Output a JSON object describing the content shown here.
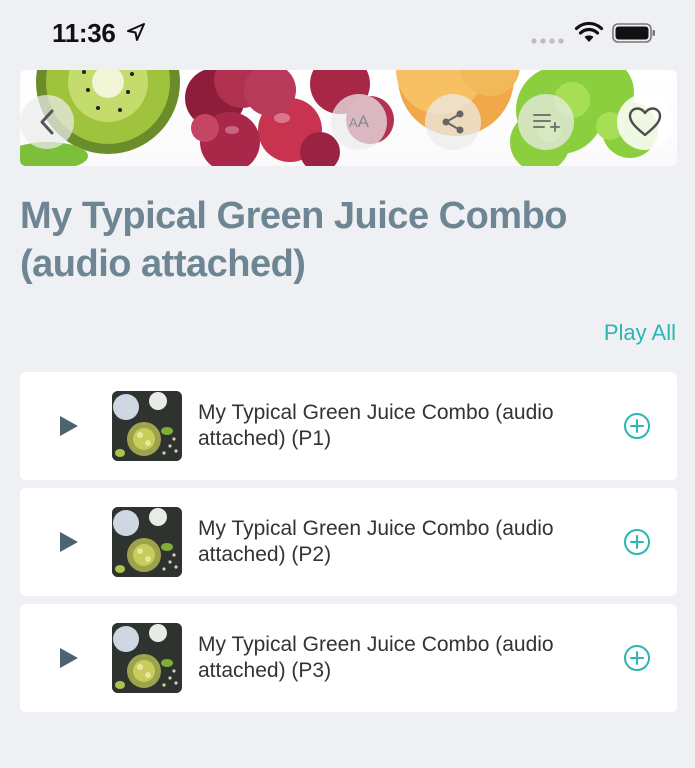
{
  "status_bar": {
    "time": "11:36"
  },
  "hero": {
    "font_button_label_big": "A",
    "font_button_label_small": "A"
  },
  "page": {
    "title": "My Typical Green Juice Combo (audio attached)",
    "play_all_label": "Play All"
  },
  "tracks": [
    {
      "label": "My Typical Green Juice Combo (audio attached) (P1)"
    },
    {
      "label": "My Typical Green Juice Combo (audio attached) (P2)"
    },
    {
      "label": "My Typical Green Juice Combo (audio attached) (P3)"
    }
  ],
  "colors": {
    "accent": "#2ab6b1",
    "title": "#6e8694",
    "background": "#eef0f3",
    "play_icon": "#4d6470"
  },
  "icons": {
    "back": "chevron-left-icon",
    "font": "font-size-icon",
    "share": "share-icon",
    "playlist": "playlist-add-icon",
    "favorite": "heart-icon",
    "play": "play-icon",
    "add": "plus-circle-icon"
  }
}
